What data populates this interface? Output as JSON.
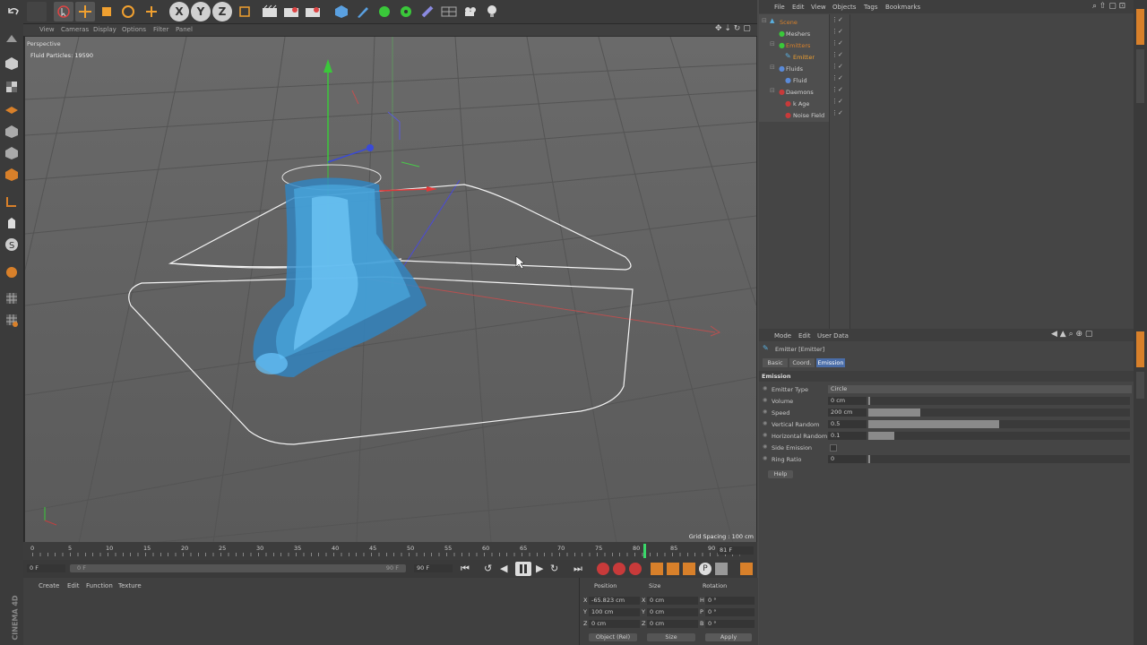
{
  "toolbar": {
    "axis_x": "X",
    "axis_y": "Y",
    "axis_z": "Z"
  },
  "viewport": {
    "menu": [
      "View",
      "Cameras",
      "Display",
      "Options",
      "Filter",
      "Panel"
    ],
    "camera": "Perspective",
    "particles": "Fluid Particles: 19590",
    "grid_spacing": "Grid Spacing : 100 cm"
  },
  "timeline": {
    "ticks": [
      "0",
      "5",
      "10",
      "15",
      "20",
      "25",
      "30",
      "35",
      "40",
      "45",
      "50",
      "55",
      "60",
      "65",
      "70",
      "75",
      "80",
      "85",
      "90"
    ],
    "current_frame": "81 F",
    "start_frame": "0 F",
    "range_start": "0 F",
    "range_end": "90 F",
    "end_frame": "90 F"
  },
  "material_manager": {
    "menu": [
      "Create",
      "Edit",
      "Function",
      "Texture"
    ]
  },
  "coordinates": {
    "headers": [
      "Position",
      "Size",
      "Rotation"
    ],
    "pos": [
      {
        "axis": "X",
        "value": "-65.823 cm"
      },
      {
        "axis": "Y",
        "value": "100 cm"
      },
      {
        "axis": "Z",
        "value": "0 cm"
      }
    ],
    "size": [
      {
        "axis": "X",
        "value": "0 cm"
      },
      {
        "axis": "Y",
        "value": "0 cm"
      },
      {
        "axis": "Z",
        "value": "0 cm"
      }
    ],
    "rot": [
      {
        "axis": "H",
        "value": "0 °"
      },
      {
        "axis": "P",
        "value": "0 °"
      },
      {
        "axis": "B",
        "value": "0 °"
      }
    ],
    "mode_select": "Object (Rel)",
    "size_select": "Size",
    "apply": "Apply"
  },
  "brand": "CINEMA 4D",
  "object_manager": {
    "menu": [
      "File",
      "Edit",
      "View",
      "Objects",
      "Tags",
      "Bookmarks"
    ],
    "objects": [
      {
        "name": "Scene",
        "indent": 0,
        "color": "#d8802a"
      },
      {
        "name": "Meshers",
        "indent": 1,
        "color": "#d0d0d0"
      },
      {
        "name": "Emitters",
        "indent": 1,
        "color": "#d8802a"
      },
      {
        "name": "Emitter",
        "indent": 2,
        "color": "#f0a030"
      },
      {
        "name": "Fluids",
        "indent": 1,
        "color": "#d0d0d0"
      },
      {
        "name": "Fluid",
        "indent": 2,
        "color": "#d0d0d0"
      },
      {
        "name": "Daemons",
        "indent": 1,
        "color": "#d0d0d0"
      },
      {
        "name": "k Age",
        "indent": 2,
        "color": "#d0d0d0"
      },
      {
        "name": "Noise Field",
        "indent": 2,
        "color": "#d0d0d0"
      }
    ]
  },
  "attribute_manager": {
    "menu": [
      "Mode",
      "Edit",
      "User Data"
    ],
    "title": "Emitter [Emitter]",
    "tabs": [
      "Basic",
      "Coord.",
      "Emission"
    ],
    "section": "Emission",
    "emitter_type_label": "Emitter Type",
    "emitter_type_value": "Circle",
    "params": [
      {
        "label": "Volume",
        "value": "0 cm",
        "fill": 0.0
      },
      {
        "label": "Speed",
        "value": "200 cm",
        "fill": 0.2
      },
      {
        "label": "Vertical Random",
        "value": "0.5",
        "fill": 0.5
      },
      {
        "label": "Horizontal Random",
        "value": "0.1",
        "fill": 0.1
      },
      {
        "label": "Side Emission",
        "value": "",
        "fill": null
      },
      {
        "label": "Ring Ratio",
        "value": "0",
        "fill": 0.0
      }
    ],
    "help": "Help"
  },
  "colors": {
    "accent_orange": "#d8802a",
    "axis_red": "#d83a3a",
    "axis_green": "#3ac83a",
    "axis_blue": "#3a4ad8",
    "particle": "#3a9ad8",
    "selected_tab": "#4a6da8"
  }
}
